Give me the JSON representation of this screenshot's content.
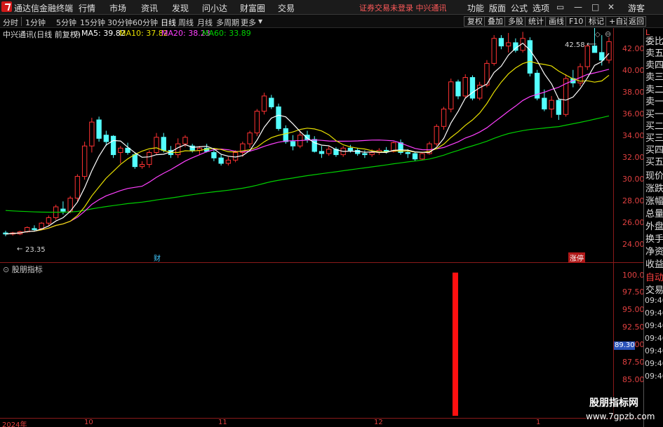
{
  "titlebar": {
    "app_title": "通达信金融终端",
    "menus": [
      "行情",
      "市场",
      "资讯",
      "发现",
      "问小达",
      "财富圈",
      "交易"
    ],
    "trade_warning": "证券交易未登录  中兴通讯",
    "right_menus": [
      "功能",
      "版面",
      "公式",
      "选项"
    ],
    "guest": "游客"
  },
  "toolbar": {
    "periods": [
      "分时",
      "1分钟",
      "5分钟",
      "15分钟",
      "30分钟",
      "60分钟",
      "日线",
      "周线",
      "月线",
      "多周期",
      "更多"
    ],
    "active_period": "日线",
    "buttons": [
      "复权",
      "叠加",
      "多股",
      "统计",
      "画线",
      "F10",
      "标记",
      "+自选",
      "返回"
    ]
  },
  "info": {
    "stock": "中兴通讯(日线 前复权)",
    "ma5": "MA5: 39.82",
    "ma10": "MA10: 37.82",
    "ma20": "MA20: 38.23",
    "ma60": "MA60: 33.89"
  },
  "right_panel": {
    "mode": "L",
    "labels": [
      "委比",
      "卖五",
      "卖四",
      "卖三",
      "卖二",
      "卖一",
      "买一",
      "买二",
      "买三",
      "买四",
      "买五",
      "现价",
      "涨跌",
      "涨幅",
      "总量",
      "外盘",
      "换手",
      "净资",
      "收益",
      "自动",
      "交易"
    ],
    "times": [
      "09:46",
      "09:46",
      "09:46",
      "09:46",
      "09:46",
      "09:46",
      "09:46"
    ]
  },
  "main_axis": {
    "ticks": [
      "42.00",
      "40.00",
      "38.00",
      "36.00",
      "34.00",
      "32.00",
      "30.00",
      "28.00",
      "26.00",
      "24.00"
    ]
  },
  "annotations": {
    "high": "42.58",
    "low": "23.35",
    "cai": "财",
    "zhangting": "涨停"
  },
  "indicator": {
    "name": "股朋指标",
    "ticks": [
      "100.0",
      "97.50",
      "95.00",
      "92.50",
      "90.00",
      "87.50",
      "85.00"
    ],
    "current_value": "89.30"
  },
  "date_axis": [
    "2024年",
    "10",
    "11",
    "12",
    "1"
  ],
  "watermark": {
    "line1": "股朋指标网",
    "line2": "www.7gpzb.com"
  },
  "colors": {
    "up": "#ff3232",
    "down": "#54ffff",
    "ma5": "#ffffff",
    "ma10": "#e8e000",
    "ma20": "#ff40ff",
    "ma60": "#00d000"
  },
  "chart_data": [
    {
      "type": "candlestick",
      "title": "中兴通讯(日线 前复权)",
      "ylim": [
        23,
        43
      ],
      "x_labels": [
        "10",
        "11",
        "12",
        "1"
      ],
      "series": [
        {
          "name": "MA5",
          "value": 39.82
        },
        {
          "name": "MA10",
          "value": 37.82
        },
        {
          "name": "MA20",
          "value": 38.23
        },
        {
          "name": "MA60",
          "value": 33.89
        }
      ],
      "ohlc": [
        [
          23.6,
          23.8,
          23.3,
          23.5
        ],
        [
          23.5,
          23.7,
          23.35,
          23.6
        ],
        [
          23.5,
          23.8,
          23.4,
          23.7
        ],
        [
          23.7,
          24.2,
          23.6,
          24.1
        ],
        [
          24.0,
          24.3,
          23.8,
          23.9
        ],
        [
          24.0,
          24.6,
          23.9,
          24.5
        ],
        [
          24.5,
          25.2,
          24.3,
          25.0
        ],
        [
          25.0,
          26.2,
          24.8,
          26.0
        ],
        [
          25.8,
          26.5,
          25.3,
          25.6
        ],
        [
          25.6,
          27.0,
          25.4,
          26.8
        ],
        [
          26.8,
          29.0,
          26.5,
          28.8
        ],
        [
          28.8,
          32.0,
          28.5,
          31.6
        ],
        [
          31.6,
          34.2,
          31.0,
          33.8
        ],
        [
          34.0,
          34.3,
          32.0,
          32.3
        ],
        [
          32.6,
          33.0,
          31.6,
          32.0
        ],
        [
          32.5,
          32.6,
          30.5,
          30.8
        ],
        [
          31.0,
          31.6,
          30.0,
          31.4
        ],
        [
          31.4,
          31.9,
          30.8,
          31.0
        ],
        [
          30.8,
          31.0,
          29.5,
          29.7
        ],
        [
          29.7,
          30.2,
          29.5,
          29.9
        ],
        [
          29.9,
          31.2,
          29.6,
          31.0
        ],
        [
          31.0,
          32.8,
          30.8,
          32.4
        ],
        [
          32.4,
          32.8,
          31.0,
          31.2
        ],
        [
          31.2,
          31.6,
          30.5,
          30.8
        ],
        [
          30.8,
          32.3,
          30.5,
          31.8
        ],
        [
          31.8,
          32.6,
          31.5,
          32.4
        ],
        [
          31.6,
          31.8,
          31.0,
          31.2
        ],
        [
          31.2,
          31.6,
          30.8,
          31.4
        ],
        [
          31.4,
          31.8,
          31.0,
          31.1
        ],
        [
          31.0,
          31.2,
          30.2,
          30.5
        ],
        [
          30.5,
          30.8,
          29.8,
          30.0
        ],
        [
          30.0,
          30.6,
          29.8,
          30.3
        ],
        [
          30.3,
          31.2,
          30.1,
          31.0
        ],
        [
          31.0,
          32.0,
          30.6,
          31.8
        ],
        [
          31.8,
          33.0,
          31.4,
          32.8
        ],
        [
          32.8,
          35.0,
          32.5,
          34.8
        ],
        [
          34.8,
          36.5,
          34.5,
          36.2
        ],
        [
          36.0,
          36.3,
          35.0,
          35.2
        ],
        [
          35.2,
          35.5,
          33.0,
          33.2
        ],
        [
          33.2,
          33.5,
          31.8,
          32.0
        ],
        [
          32.0,
          32.6,
          31.2,
          31.6
        ],
        [
          31.6,
          33.0,
          31.4,
          32.6
        ],
        [
          32.6,
          33.0,
          31.9,
          32.2
        ],
        [
          32.2,
          32.5,
          31.0,
          31.1
        ],
        [
          31.1,
          31.6,
          30.5,
          30.9
        ],
        [
          30.9,
          31.6,
          30.7,
          31.3
        ],
        [
          31.3,
          31.5,
          30.6,
          30.8
        ],
        [
          30.8,
          31.6,
          30.6,
          31.4
        ],
        [
          31.4,
          31.7,
          31.0,
          31.2
        ],
        [
          31.2,
          31.4,
          30.7,
          30.9
        ],
        [
          30.9,
          31.2,
          30.5,
          30.8
        ],
        [
          30.8,
          31.3,
          30.6,
          31.0
        ],
        [
          31.0,
          31.4,
          30.8,
          31.2
        ],
        [
          31.2,
          31.5,
          30.9,
          31.1
        ],
        [
          31.1,
          32.0,
          31.0,
          31.9
        ],
        [
          31.9,
          32.2,
          30.8,
          31.0
        ],
        [
          31.0,
          31.3,
          30.5,
          30.9
        ],
        [
          30.9,
          31.0,
          30.2,
          30.4
        ],
        [
          30.4,
          31.0,
          30.3,
          30.9
        ],
        [
          30.9,
          32.0,
          30.8,
          31.8
        ],
        [
          31.8,
          33.6,
          31.6,
          33.4
        ],
        [
          33.4,
          35.2,
          33.1,
          35.0
        ],
        [
          35.0,
          37.8,
          34.7,
          37.5
        ],
        [
          37.5,
          37.7,
          35.9,
          36.2
        ],
        [
          36.2,
          38.2,
          36.0,
          37.9
        ],
        [
          37.9,
          38.1,
          35.8,
          36.0
        ],
        [
          36.0,
          37.5,
          35.8,
          37.2
        ],
        [
          37.2,
          39.5,
          37.0,
          39.2
        ],
        [
          39.2,
          41.8,
          39.0,
          41.5
        ],
        [
          41.5,
          41.8,
          40.5,
          40.8
        ],
        [
          40.8,
          42.0,
          40.2,
          41.1
        ],
        [
          41.1,
          41.5,
          40.2,
          40.4
        ],
        [
          40.4,
          42.1,
          40.2,
          41.5
        ],
        [
          41.3,
          41.6,
          38.0,
          38.3
        ],
        [
          38.3,
          38.6,
          35.8,
          36.0
        ],
        [
          36.0,
          36.8,
          34.8,
          35.0
        ],
        [
          35.0,
          36.2,
          34.2,
          35.8
        ],
        [
          35.8,
          36.0,
          34.0,
          34.5
        ],
        [
          34.5,
          38.2,
          34.3,
          37.8
        ],
        [
          37.8,
          38.6,
          37.0,
          37.4
        ],
        [
          37.4,
          39.2,
          37.1,
          38.9
        ],
        [
          38.9,
          41.0,
          38.6,
          40.8
        ],
        [
          40.8,
          42.58,
          40.4,
          40.2
        ],
        [
          40.2,
          41.8,
          39.0,
          39.5
        ],
        [
          39.5,
          41.6,
          39.2,
          41.2
        ]
      ]
    },
    {
      "type": "bar",
      "title": "股朋指标",
      "ylim": [
        82.5,
        101
      ],
      "bars": [
        {
          "position": "mid-December",
          "value": 100.0,
          "color": "red"
        }
      ],
      "current_value": 89.3
    }
  ]
}
